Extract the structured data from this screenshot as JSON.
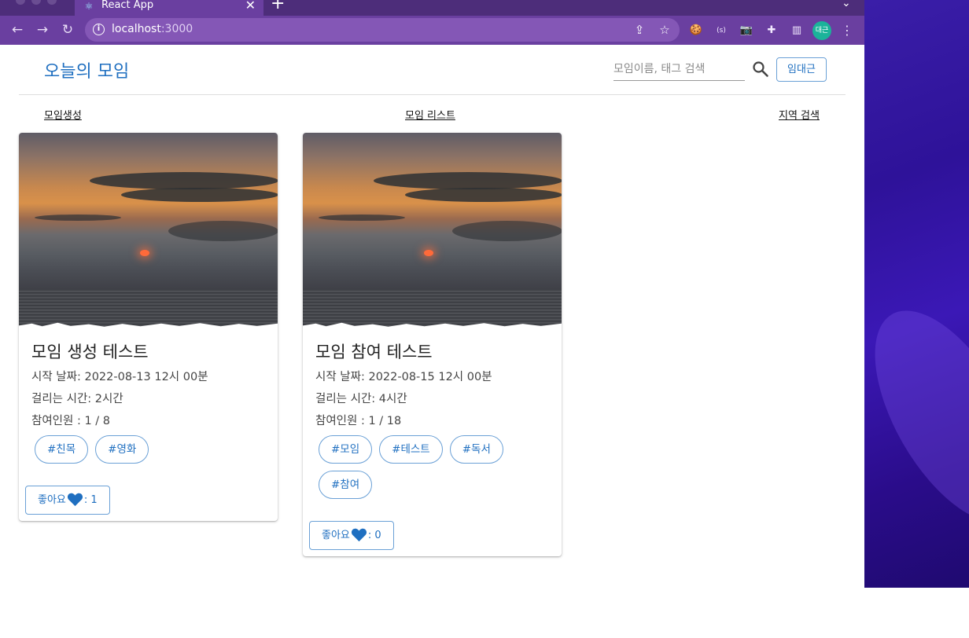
{
  "browser": {
    "tab_title": "React App",
    "url_host": "localhost",
    "url_port": ":3000",
    "avatar_text": "대근"
  },
  "header": {
    "brand": "오늘의 모임",
    "search_placeholder": "모임이름, 태그 검색",
    "user_button": "임대근"
  },
  "nav": {
    "create": "모임생성",
    "list": "모임 리스트",
    "region_search": "지역 검색"
  },
  "cards": [
    {
      "title": "모임 생성 테스트",
      "start": "시작 날짜: 2022-08-13 12시 00분",
      "duration": "걸리는 시간: 2시간",
      "members": "참여인원 : 1 / 8",
      "tags": [
        "#친목",
        "#영화"
      ],
      "like_label": "좋아요",
      "like_count": ": 1"
    },
    {
      "title": "모임 참여 테스트",
      "start": "시작 날짜: 2022-08-15 12시 00분",
      "duration": "걸리는 시간: 4시간",
      "members": "참여인원 : 1 / 18",
      "tags": [
        "#모임",
        "#테스트",
        "#독서",
        "#참여"
      ],
      "like_label": "좋아요",
      "like_count": ": 0"
    }
  ],
  "colors": {
    "brand_blue": "#1f6fc0",
    "heart_blue": "#1f6fc0",
    "chrome_purple": "#6a3fa0"
  }
}
